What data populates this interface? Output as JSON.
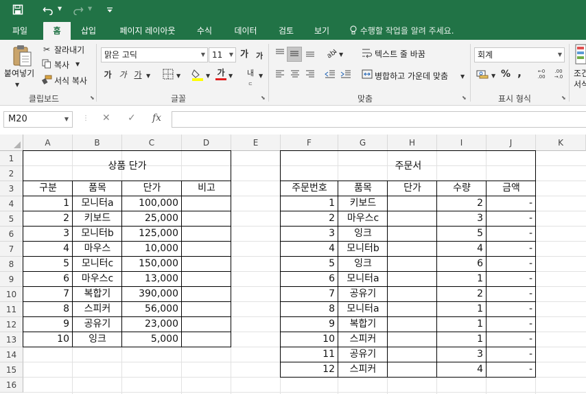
{
  "qat": {
    "save_icon": "save-icon",
    "undo_icon": "undo-icon",
    "redo_icon": "redo-icon",
    "customize_icon": "customize-qat-icon"
  },
  "tabs": [
    {
      "label": "파일"
    },
    {
      "label": "홈"
    },
    {
      "label": "삽입"
    },
    {
      "label": "페이지 레이아웃"
    },
    {
      "label": "수식"
    },
    {
      "label": "데이터"
    },
    {
      "label": "검토"
    },
    {
      "label": "보기"
    }
  ],
  "tell_me": "수행할 작업을 알려 주세요.",
  "ribbon": {
    "clipboard": {
      "paste": "붙여넣기",
      "cut": "잘라내기",
      "copy": "복사",
      "format_painter": "서식 복사",
      "label": "클립보드"
    },
    "font": {
      "name": "맑은 고딕",
      "size": "11",
      "label": "글꼴"
    },
    "alignment": {
      "wrap_text": "텍스트 줄 바꿈",
      "merge_center": "병합하고 가운데 맞춤",
      "label": "맞춤"
    },
    "number": {
      "format": "회계",
      "label": "표시 형식"
    },
    "styles": {
      "partial1": "조건",
      "partial2": "서식"
    }
  },
  "formula_bar": {
    "name_box": "M20",
    "cancel": "✕",
    "enter": "✓",
    "fx": "fx",
    "value": ""
  },
  "columns": [
    "A",
    "B",
    "C",
    "D",
    "E",
    "F",
    "G",
    "H",
    "I",
    "J",
    "K"
  ],
  "rows": [
    "1",
    "2",
    "3",
    "4",
    "5",
    "6",
    "7",
    "8",
    "9",
    "10",
    "11",
    "12",
    "13",
    "14",
    "15",
    "16"
  ],
  "price_table": {
    "title": "상품 단가",
    "headers": [
      "구분",
      "품목",
      "단가",
      "비고"
    ],
    "rows": [
      [
        "1",
        "모니터a",
        "100,000",
        ""
      ],
      [
        "2",
        "키보드",
        "25,000",
        ""
      ],
      [
        "3",
        "모니터b",
        "125,000",
        ""
      ],
      [
        "4",
        "마우스",
        "10,000",
        ""
      ],
      [
        "5",
        "모니터c",
        "150,000",
        ""
      ],
      [
        "6",
        "마우스c",
        "13,000",
        ""
      ],
      [
        "7",
        "복합기",
        "390,000",
        ""
      ],
      [
        "8",
        "스피커",
        "56,000",
        ""
      ],
      [
        "9",
        "공유기",
        "23,000",
        ""
      ],
      [
        "10",
        "잉크",
        "5,000",
        ""
      ]
    ]
  },
  "order_table": {
    "title": "주문서",
    "headers": [
      "주문번호",
      "품목",
      "단가",
      "수량",
      "금액"
    ],
    "rows": [
      [
        "1",
        "키보드",
        "",
        "2",
        "-"
      ],
      [
        "2",
        "마우스c",
        "",
        "3",
        "-"
      ],
      [
        "3",
        "잉크",
        "",
        "5",
        "-"
      ],
      [
        "4",
        "모니터b",
        "",
        "4",
        "-"
      ],
      [
        "5",
        "잉크",
        "",
        "6",
        "-"
      ],
      [
        "6",
        "모니터a",
        "",
        "1",
        "-"
      ],
      [
        "7",
        "공유기",
        "",
        "2",
        "-"
      ],
      [
        "8",
        "모니터a",
        "",
        "1",
        "-"
      ],
      [
        "9",
        "복합기",
        "",
        "1",
        "-"
      ],
      [
        "10",
        "스피커",
        "",
        "1",
        "-"
      ],
      [
        "11",
        "공유기",
        "",
        "3",
        "-"
      ],
      [
        "12",
        "스피커",
        "",
        "4",
        "-"
      ]
    ]
  },
  "colors": {
    "accent": "#217346",
    "ribbon_bg": "#f3f3f3",
    "header_bg": "#f3f3f3",
    "gridline": "#e1e1e1"
  }
}
